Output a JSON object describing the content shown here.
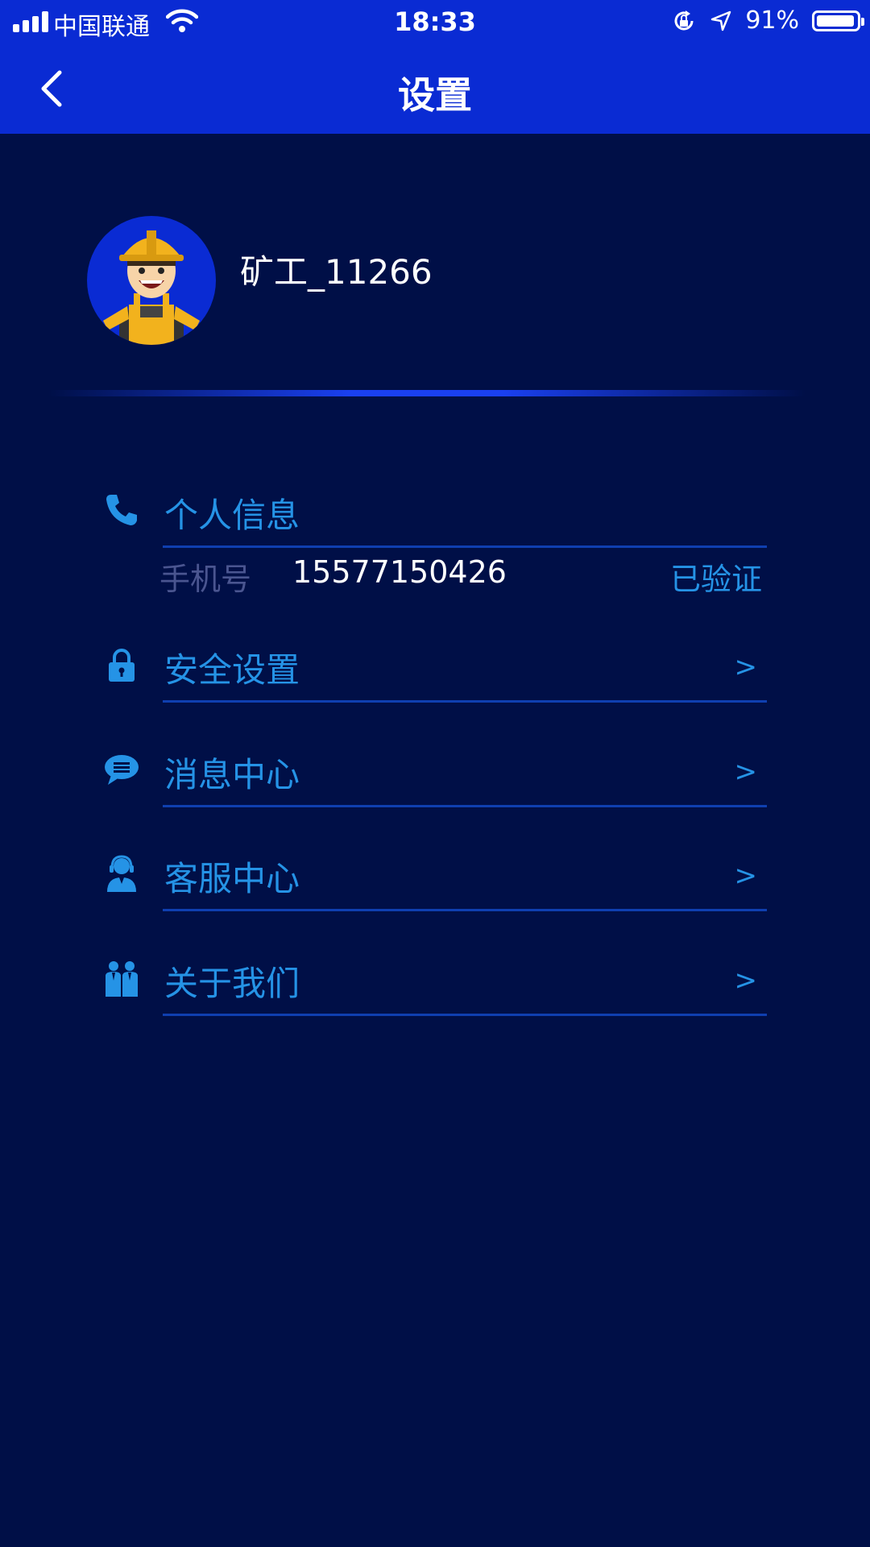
{
  "status_bar": {
    "carrier": "中国联通",
    "time": "18:33",
    "battery": "91%"
  },
  "nav": {
    "title": "设置"
  },
  "profile": {
    "username": "矿工_11266"
  },
  "personal_info": {
    "label": "个人信息",
    "phone_label": "手机号",
    "phone_value": "15577150426",
    "verified": "已验证"
  },
  "menu": [
    {
      "label": "安全设置",
      "arrow": ">",
      "icon": "lock-icon"
    },
    {
      "label": "消息中心",
      "arrow": ">",
      "icon": "chat-bubble-icon"
    },
    {
      "label": "客服中心",
      "arrow": ">",
      "icon": "customer-service-icon"
    },
    {
      "label": "关于我们",
      "arrow": ">",
      "icon": "people-icon"
    }
  ],
  "colors": {
    "background": "#000f47",
    "header": "#0a2bd3",
    "accent": "#2593e6"
  }
}
